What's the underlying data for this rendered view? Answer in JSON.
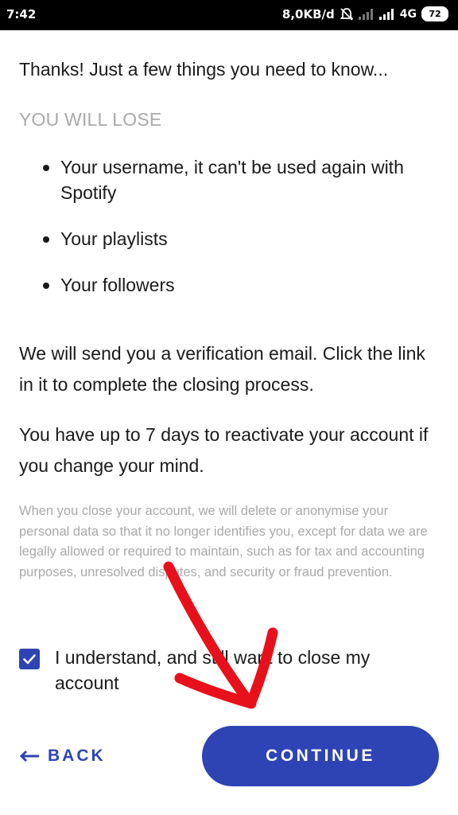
{
  "status_bar": {
    "time": "7:42",
    "net_speed": "8,0KB/d",
    "network_type": "4G",
    "battery_level": "72",
    "icons": [
      "alarm-off-icon",
      "signal-weak-icon",
      "signal-strong-icon",
      "battery-icon"
    ]
  },
  "main": {
    "intro": "Thanks! Just a few things you need to know...",
    "lose_heading": "YOU WILL LOSE",
    "lose_items": [
      "Your username, it can't be used again with Spotify",
      "Your playlists",
      "Your followers"
    ],
    "verification_text": "We will send you a verification email. Click the link in it to complete the closing process.",
    "reactivate_text": "You have up to 7 days to reactivate your account if you change your mind.",
    "fine_print": "When you close your account, we will delete or anonymise your personal data so that it no longer identifies you, except for data we are legally allowed or required to maintain, such as for tax and accounting purposes, unresolved disputes, and security or fraud prevention.",
    "confirm_label": "I understand, and still want to close my account",
    "confirm_checked": true
  },
  "actions": {
    "back_label": "BACK",
    "continue_label": "CONTINUE"
  },
  "colors": {
    "accent": "#2e44b4",
    "annotation": "#e8111b",
    "muted_text": "#a9a9a9"
  }
}
